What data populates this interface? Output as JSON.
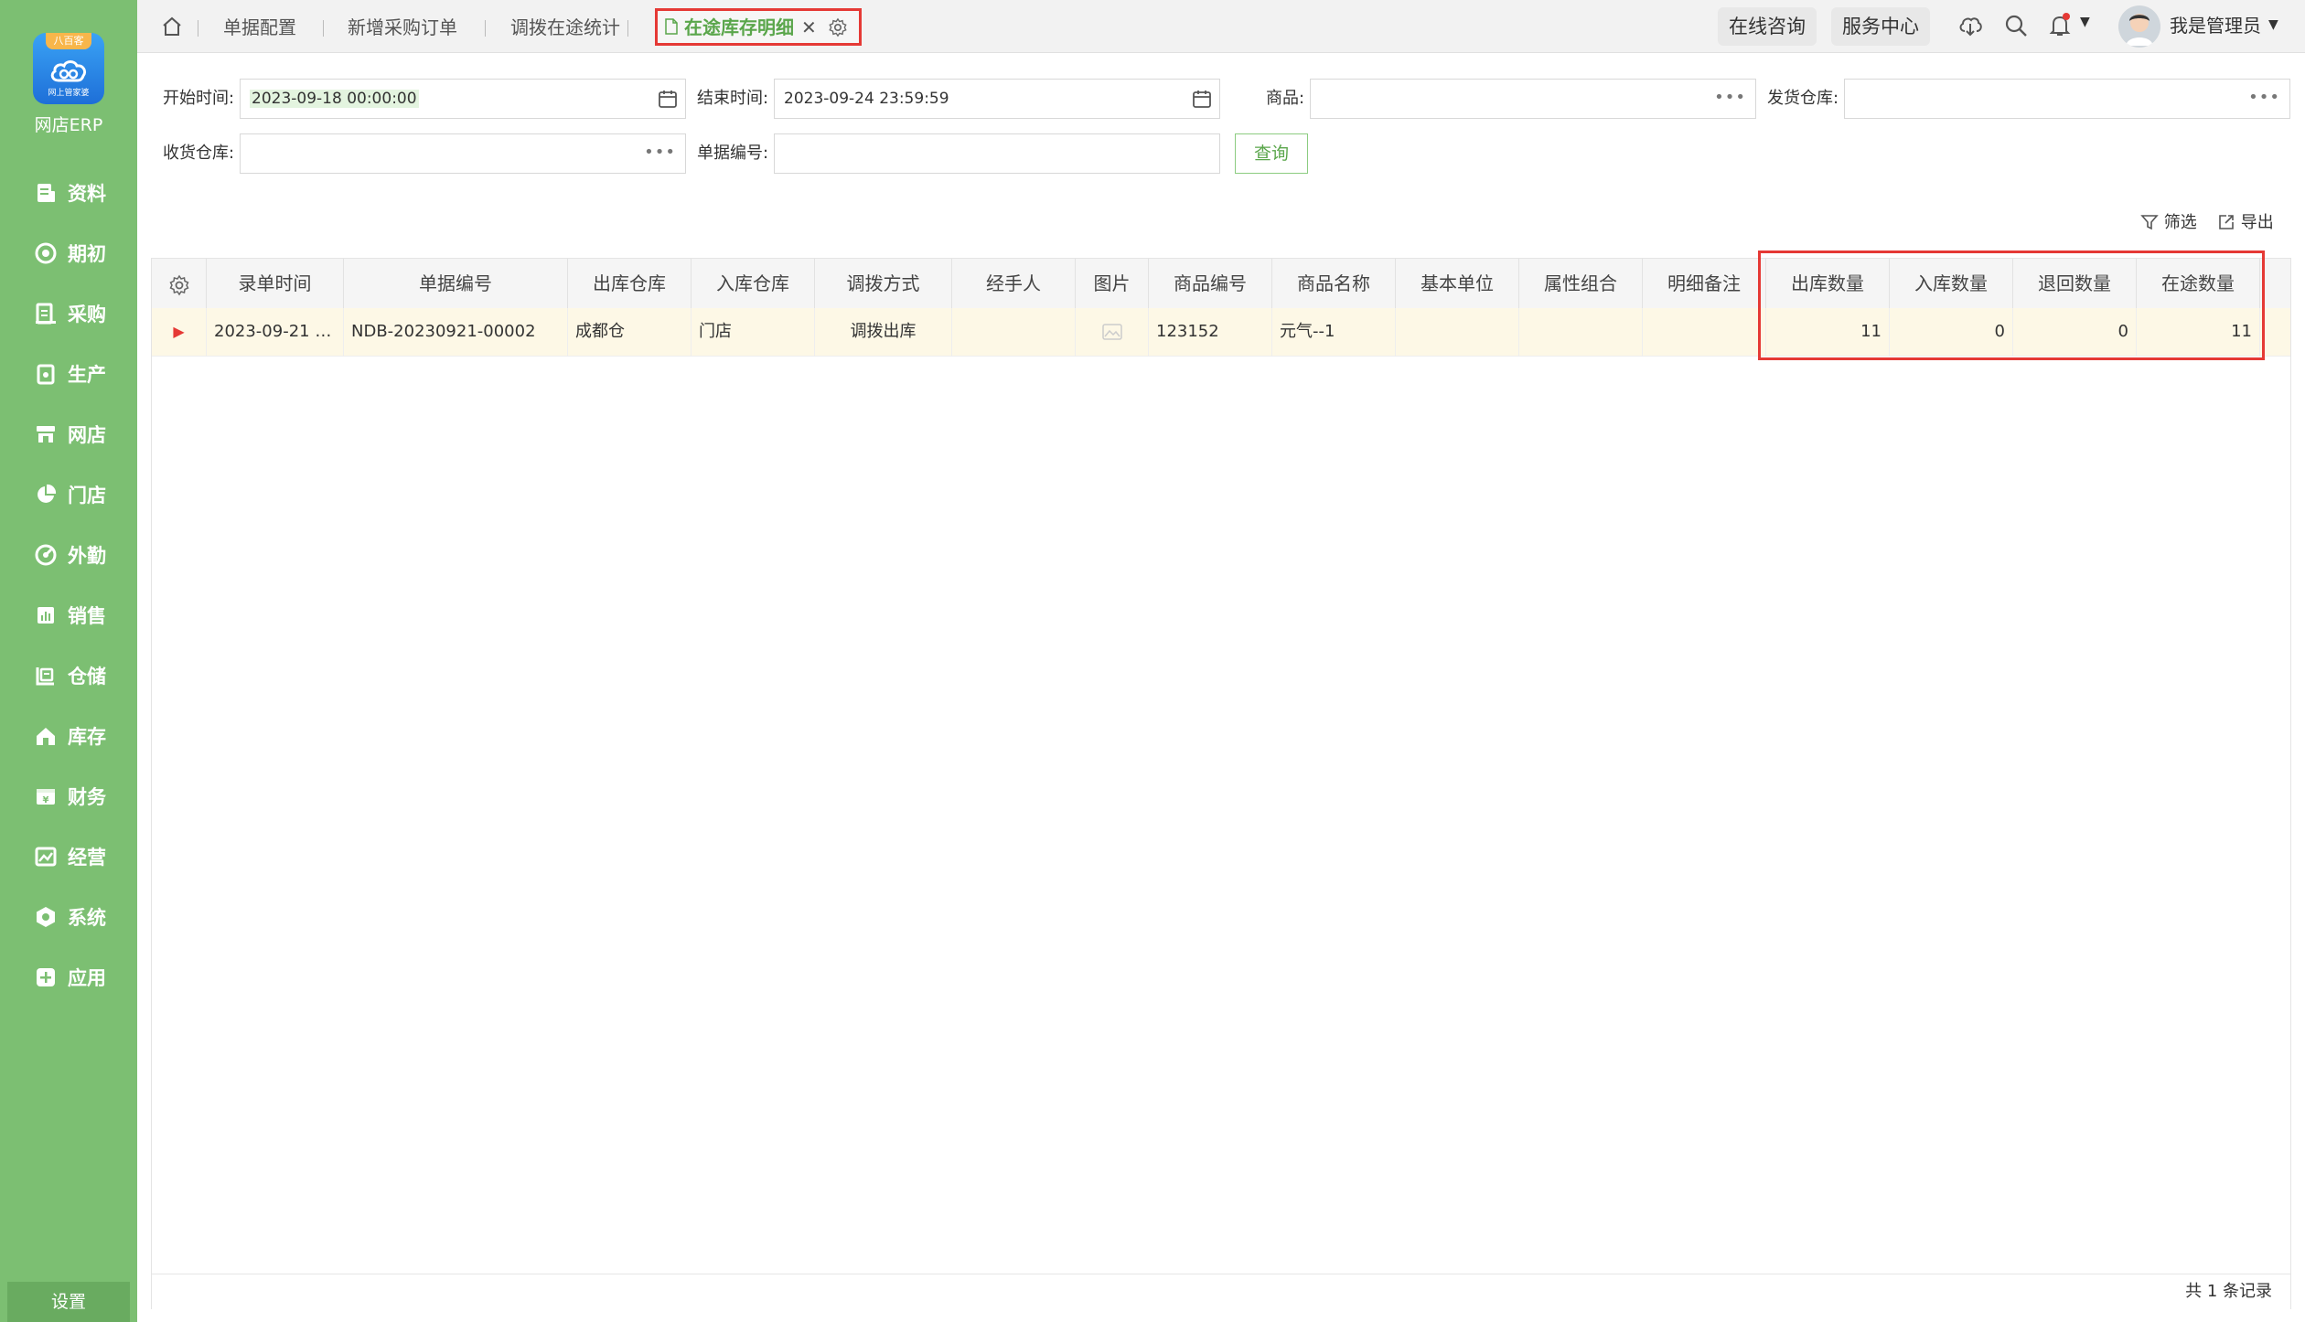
{
  "brand": {
    "name": "网店ERP",
    "ribbon": "八百客",
    "logo_text": "网上管家婆"
  },
  "sidebar": {
    "items": [
      {
        "label": "资料",
        "icon": "document-icon"
      },
      {
        "label": "期初",
        "icon": "target-icon"
      },
      {
        "label": "采购",
        "icon": "list-icon"
      },
      {
        "label": "生产",
        "icon": "factory-icon"
      },
      {
        "label": "网店",
        "icon": "store-icon"
      },
      {
        "label": "门店",
        "icon": "pie-icon"
      },
      {
        "label": "外勤",
        "icon": "gauge-icon"
      },
      {
        "label": "销售",
        "icon": "bar-chart-icon"
      },
      {
        "label": "仓储",
        "icon": "warehouse-icon"
      },
      {
        "label": "库存",
        "icon": "home-icon"
      },
      {
        "label": "财务",
        "icon": "wallet-icon"
      },
      {
        "label": "经营",
        "icon": "image-icon"
      },
      {
        "label": "系统",
        "icon": "hexagon-icon"
      },
      {
        "label": "应用",
        "icon": "plus-icon"
      }
    ],
    "settings_label": "设置"
  },
  "tabs": {
    "items": [
      "单据配置",
      "新增采购订单",
      "调拨在途统计"
    ],
    "active": "在途库存明细"
  },
  "header": {
    "online_consult": "在线咨询",
    "service_center": "服务中心",
    "user_name": "我是管理员"
  },
  "filters": {
    "start_label": "开始时间:",
    "start_value": "2023-09-18 00:00:00",
    "end_label": "结束时间:",
    "end_value": "2023-09-24 23:59:59",
    "product_label": "商品:",
    "product_value": "",
    "send_wh_label": "发货仓库:",
    "send_wh_value": "",
    "recv_wh_label": "收货仓库:",
    "recv_wh_value": "",
    "order_no_label": "单据编号:",
    "order_no_value": "",
    "query_label": "查询"
  },
  "toolbar": {
    "filter_label": "筛选",
    "export_label": "导出"
  },
  "table": {
    "columns": [
      "录单时间",
      "单据编号",
      "出库仓库",
      "入库仓库",
      "调拨方式",
      "经手人",
      "图片",
      "商品编号",
      "商品名称",
      "基本单位",
      "属性组合",
      "明细备注",
      "出库数量",
      "入库数量",
      "退回数量",
      "在途数量"
    ],
    "rows": [
      [
        "2023-09-21 1...",
        "NDB-20230921-00002",
        "成都仓",
        "门店",
        "调拨出库",
        "",
        "",
        "123152",
        "元气--1",
        "",
        "",
        "",
        "11",
        "0",
        "0",
        "11"
      ]
    ],
    "footer": "共 1 条记录"
  }
}
